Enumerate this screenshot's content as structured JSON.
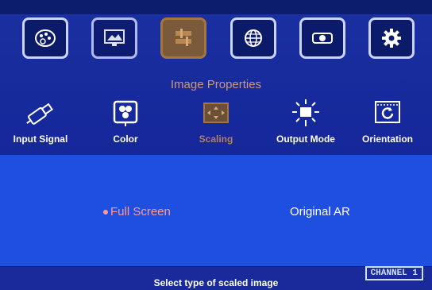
{
  "menu": {
    "top_icons": [
      {
        "icon": "palette-icon"
      },
      {
        "icon": "monitor-image-icon"
      },
      {
        "icon": "image-properties-icon",
        "active": true
      },
      {
        "icon": "globe-icon"
      },
      {
        "icon": "projector-icon"
      },
      {
        "icon": "settings-gear-icon"
      }
    ],
    "title": "Image Properties",
    "sub_tabs": [
      {
        "label": "Input Signal",
        "icon": "usb-cable-icon"
      },
      {
        "label": "Color",
        "icon": "color-circles-icon"
      },
      {
        "label": "Scaling",
        "icon": "scaling-arrows-icon",
        "active": true
      },
      {
        "label": "Output Mode",
        "icon": "output-sun-monitor-icon"
      },
      {
        "label": "Orientation",
        "icon": "rotate-icon"
      }
    ]
  },
  "options": {
    "full_screen": "Full Screen",
    "original_ar": "Original AR",
    "selected": "Full Screen"
  },
  "footer": {
    "hint": "Select type of scaled image",
    "channel": "CHANNEL 1"
  },
  "colors": {
    "accent_active": "#a4763f",
    "selected_option": "#ff9999",
    "content_bg": "#1f4fe0"
  }
}
